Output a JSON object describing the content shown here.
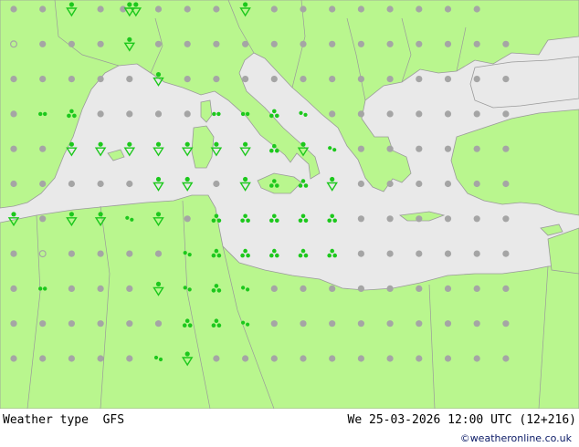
{
  "footer": {
    "title": "Weather type  GFS",
    "datetime": "We 25-03-2026 12:00 UTC (12+216)",
    "credit": "©weatheronline.co.uk"
  },
  "colors": {
    "land": "#b9f68e",
    "sea": "#e9e9e9",
    "border": "#9a9a9a",
    "dot_dry": "#a5a5a5",
    "weather_symbol": "#1cc81c"
  },
  "legend_symbols": {
    "o": "cloudy",
    "d": "partly-cloudy",
    "r": "rain",
    "s": "rain-showers",
    "t": "light-rain",
    "h": "hail",
    "x": "clear"
  },
  "grid_rows": [
    "d d s d dsr d d d r d d d d d d d d",
    "o d d d s d d d d d d d d d d d d d",
    "d d d d d s d d d d d d d d d d d d",
    "d x h d d d d x x h t d d d d d d d",
    "d d s s s s s s s h s t d d d d d d",
    "d d d d d s s d r h h s d d d d d d",
    "s d s s t s d h h h h h d d d d d d",
    "d o d d d d t h h h h h d d d d d d",
    "d x d d d s t h t d d d d d d d d d",
    "d d d d d d h h t d d d d d d d d d",
    "d d d d d t s d d d d d d d d d d d"
  ]
}
